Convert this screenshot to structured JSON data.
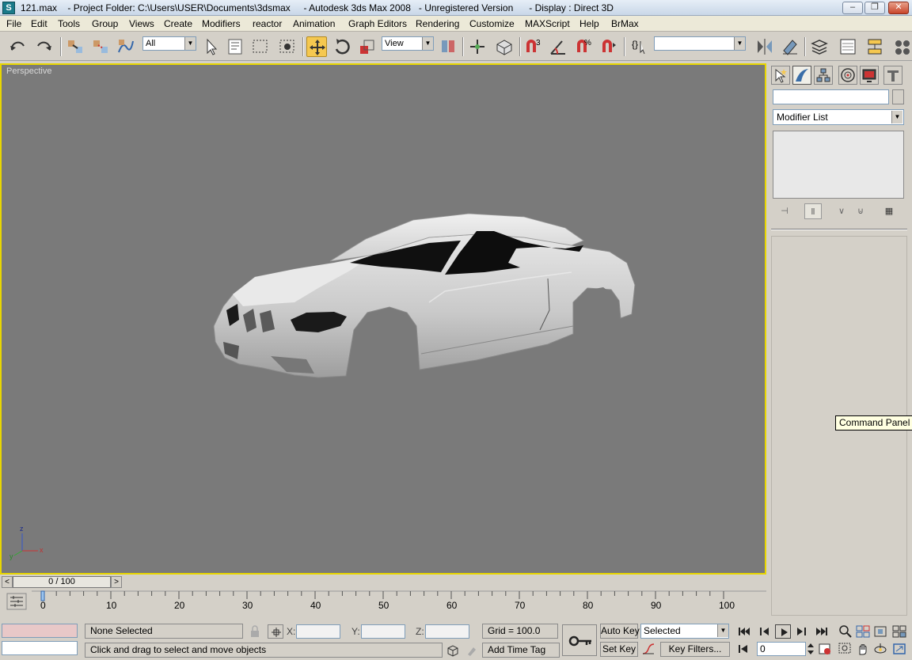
{
  "window": {
    "title": "121.max    - Project Folder: C:\\Users\\USER\\Documents\\3dsmax     - Autodesk 3ds Max 2008   - Unregistered Version      - Display : Direct 3D",
    "minimize": "–",
    "maximize": "❐",
    "close": "✕",
    "app_icon": "S"
  },
  "menu": [
    "File",
    "Edit",
    "Tools",
    "Group",
    "Views",
    "Create",
    "Modifiers",
    "reactor",
    "Animation",
    "Graph Editors",
    "Rendering",
    "Customize",
    "MAXScript",
    "Help",
    "BrMax"
  ],
  "toolbar": {
    "selection_filter": "All",
    "ref_coord": "View",
    "named_selection": "",
    "snap_angle_label": "3",
    "accent": "#f5c850"
  },
  "viewport": {
    "label": "Perspective",
    "background": "#7a7a7a",
    "border": "#e8d600",
    "axis": {
      "x": "x",
      "y": "y",
      "z": "z"
    }
  },
  "command_panel": {
    "tabs": [
      "create-icon",
      "modify-icon",
      "hierarchy-icon",
      "motion-icon",
      "display-icon",
      "utilities-icon"
    ],
    "name_value": "",
    "modifier_list": "Modifier List",
    "tooltip": "Command Panel"
  },
  "timeline": {
    "frame_readout": "0 / 100",
    "prev": "<",
    "next": ">",
    "ticks": [
      "0",
      "10",
      "20",
      "30",
      "40",
      "50",
      "60",
      "70",
      "80",
      "90",
      "100"
    ]
  },
  "status": {
    "selection": "None Selected",
    "prompt": "Click and drag to select and move objects",
    "x_label": "X:",
    "y_label": "Y:",
    "z_label": "Z:",
    "grid": "Grid = 100.0",
    "add_time_tag": "Add Time Tag",
    "auto_key": "Auto Key",
    "set_key": "Set Key",
    "key_mode": "Selected",
    "key_filters": "Key Filters...",
    "current_frame": "0"
  }
}
